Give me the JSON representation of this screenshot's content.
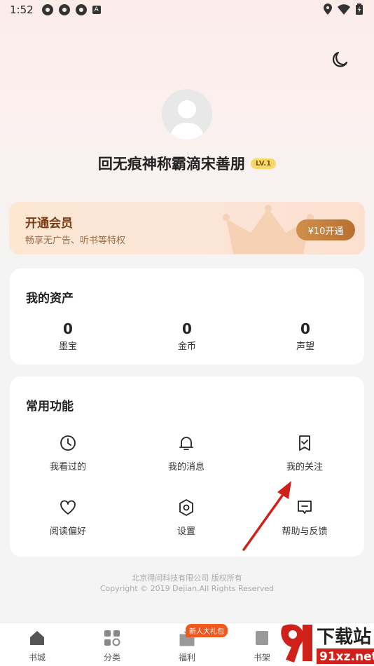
{
  "status_bar": {
    "time": "1:52",
    "notif_icon": "A"
  },
  "header": {
    "username": "回无痕神称霸滴宋善朋",
    "level": "LV.1"
  },
  "vip": {
    "title": "开通会员",
    "subtitle": "畅享无广告、听书等特权",
    "button": "¥10开通"
  },
  "assets": {
    "title": "我的资产",
    "items": [
      {
        "value": "0",
        "label": "墨宝"
      },
      {
        "value": "0",
        "label": "金币"
      },
      {
        "value": "0",
        "label": "声望"
      }
    ]
  },
  "functions": {
    "title": "常用功能",
    "items": [
      {
        "label": "我看过的",
        "icon": "clock-icon"
      },
      {
        "label": "我的消息",
        "icon": "bell-icon"
      },
      {
        "label": "我的关注",
        "icon": "bookmark-check-icon"
      },
      {
        "label": "阅读偏好",
        "icon": "heart-icon"
      },
      {
        "label": "设置",
        "icon": "gear-icon"
      },
      {
        "label": "帮助与反馈",
        "icon": "feedback-icon"
      }
    ]
  },
  "footer": {
    "company": "北京得间科技有限公司  版权所有",
    "copyright": "Copyright © 2019 Dejian.All Rights Reserved"
  },
  "tabbar": {
    "items": [
      {
        "label": "书城",
        "icon": "home-icon"
      },
      {
        "label": "分类",
        "icon": "grid-icon"
      },
      {
        "label": "福利",
        "icon": "gift-icon"
      },
      {
        "label": "书架",
        "icon": "bookshelf-icon"
      }
    ],
    "gift_badge": "新人大礼包"
  },
  "watermark": {
    "brand": "下载站",
    "domain": "91xz.net"
  },
  "colors": {
    "accent": "#b7702f",
    "vip_text": "#7a3b12",
    "badge": "#f2571d",
    "arrow": "#d0201a"
  }
}
